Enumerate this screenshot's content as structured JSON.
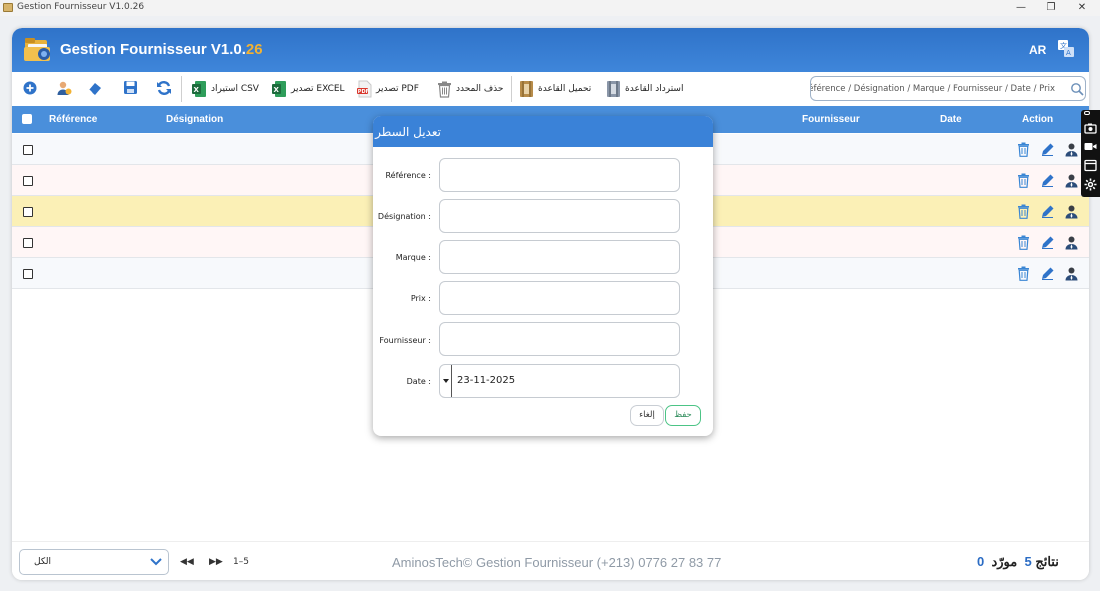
{
  "window": {
    "title": "Gestion Fournisseur V1.0.26"
  },
  "header": {
    "title_main": "Gestion Fournisseur V1.0.",
    "title_accent": "26",
    "lang": "AR"
  },
  "toolbar": {
    "import_csv": "استيراد CSV",
    "export_excel": "تصدير EXCEL",
    "export_pdf": "تصدير PDF",
    "delete_selected": "حذف المحدد",
    "load_db": "تحميل القاعدة",
    "restore_db": "استرداد القاعدة",
    "search_placeholder": "Référence / Désignation / Marque / Fournisseur / Date / Prix :بحث"
  },
  "table": {
    "columns": {
      "reference": "Référence",
      "designation": "Désignation",
      "fournisseur": "Fournisseur",
      "date": "Date",
      "action": "Action"
    },
    "row_count": 5,
    "highlight_color": "#fbf0b6"
  },
  "footer": {
    "page_select": "الكل",
    "range": "1–5",
    "copyright": "AminosTech© Gestion Fournisseur (+213) 0776 27 83 77",
    "count_suppliers": "0",
    "label_suppliers": "مورّد",
    "count_results": "5",
    "label_results": "نتائج"
  },
  "dialog": {
    "title": "تعديل السطر",
    "fields": {
      "reference": {
        "label": "Référence :",
        "value": ""
      },
      "designation": {
        "label": "Désignation :",
        "value": ""
      },
      "marque": {
        "label": "Marque :",
        "value": ""
      },
      "prix": {
        "label": "Prix :",
        "value": ""
      },
      "fournisseur": {
        "label": "Fournisseur :",
        "value": ""
      },
      "date": {
        "label": "Date :",
        "value": "23-11-2025"
      }
    },
    "cancel_label": "إلغاء",
    "save_label": "حفظ"
  },
  "colors": {
    "header_blue": "#2f73c9",
    "table_head": "#4a8fdb",
    "accent_orange": "#f2b233",
    "save_green": "#4cc486"
  }
}
